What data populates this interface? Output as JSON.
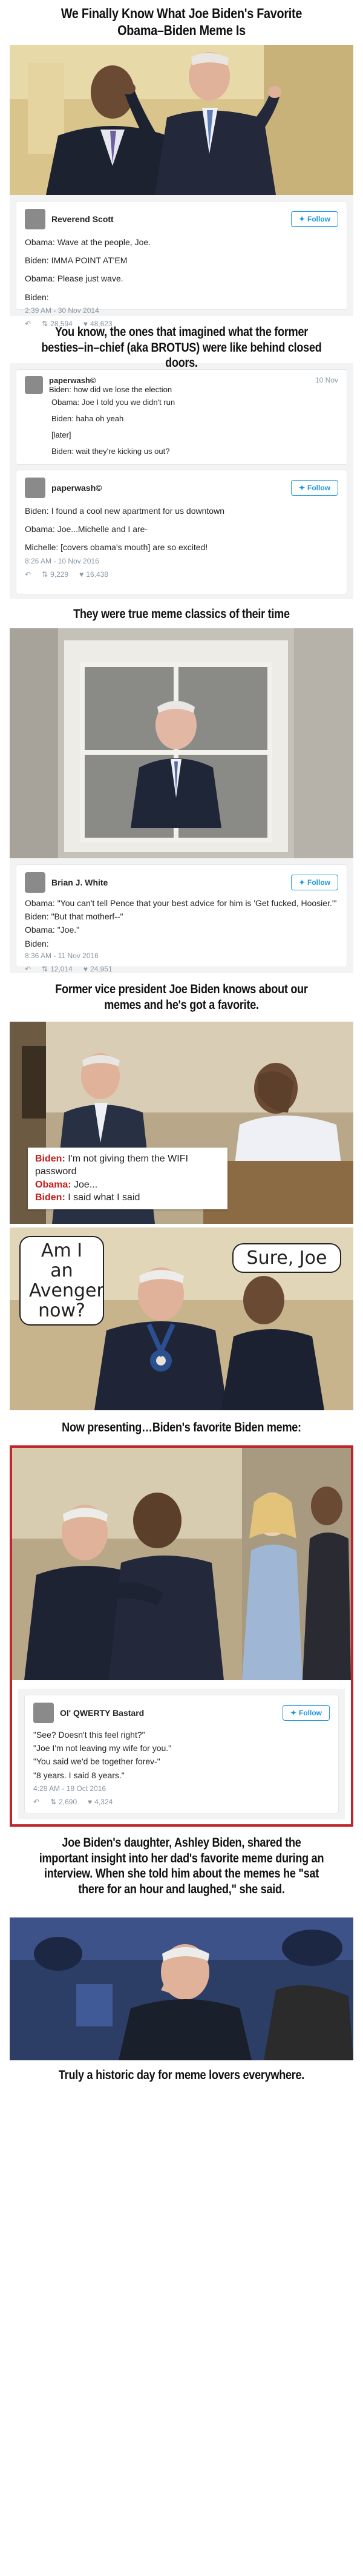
{
  "headings": {
    "h1": "We Finally Know What Joe Biden's Favorite Obama–Biden Meme Is",
    "h2": "You know, the ones that imagined what the former besties–in–chief (aka BROTUS) were like behind closed doors.",
    "h3": "They were true meme classics of their time",
    "h4": "Former vice president Joe Biden knows about our memes and he's got a favorite.",
    "h5": "Now presenting…Biden's favorite Biden meme:",
    "h6": "Joe Biden's daughter, Ashley Biden, shared the important insight into her dad's favorite meme during an interview. When she told him about the memes he \"sat there for an hour and laughed,\" she said.",
    "h7": "Truly a historic day for meme lovers everywhere."
  },
  "follow_label": "Follow",
  "tweet1": {
    "user": "Reverend Scott",
    "lines": [
      "Obama: Wave at the people, Joe.",
      "Biden: IMMA POINT AT'EM",
      "Obama: Please just wave.",
      "Biden:"
    ],
    "time": "2:39 AM - 30 Nov 2014",
    "retweets": "28,594",
    "likes": "48,623"
  },
  "reply_tweet": {
    "user": "paperwash©",
    "date": "10 Nov",
    "question": "Biden: how did we lose the election",
    "lines": [
      "Obama: Joe I told you we didn't run",
      "Biden: haha oh yeah",
      "[later]",
      "Biden: wait they're kicking us out?"
    ]
  },
  "tweet2": {
    "user": "paperwash©",
    "lines": [
      "Biden: I found a cool new apartment for us downtown",
      "Obama: Joe...Michelle and I are-",
      "Michelle: [covers obama's mouth] are so excited!"
    ],
    "time": "8:26 AM - 10 Nov 2016",
    "retweets": "9,229",
    "likes": "16,438"
  },
  "tweet3": {
    "user": "Brian J. White",
    "lines": [
      "Obama: \"You can't tell Pence that your best advice for him is 'Get fucked, Hoosier.'\"",
      "Biden: \"But that motherf--\"",
      "Obama: \"Joe.\"",
      "Biden:"
    ],
    "time": "8:36 AM - 11 Nov 2016",
    "retweets": "12,014",
    "likes": "24,951"
  },
  "caption_wifi": {
    "l1_who": "Biden:",
    "l1_text": " I'm not giving them the WIFI password",
    "l2_who": "Obama:",
    "l2_text": " Joe...",
    "l3_who": "Biden:",
    "l3_text": " I said what I said"
  },
  "bubbles": {
    "left": "Am I an Avenger now?",
    "right": "Sure, Joe"
  },
  "tweet4": {
    "user": "Ol' QWERTY Bastard",
    "lines": [
      "\"See? Doesn't this feel right?\"",
      "\"Joe I'm not leaving my wife for you.\"",
      "\"You said we'd be together forev-\"",
      "\"8 years. I said 8 years.\""
    ],
    "time": "4:28 AM - 18 Oct 2016",
    "retweets": "2,690",
    "likes": "4,324"
  },
  "icons": {
    "reply": "reply-icon",
    "retweet": "retweet-icon",
    "like": "heart-icon",
    "bird": "twitter-bird-icon"
  },
  "colors": {
    "follow": "#1b95e0",
    "frame": "#c0242c",
    "caption_name": "#c31d1d"
  }
}
